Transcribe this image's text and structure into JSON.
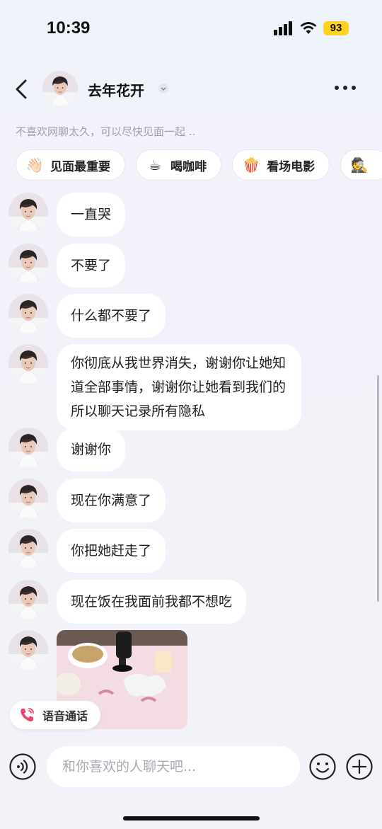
{
  "status_bar": {
    "time": "10:39",
    "battery": "93"
  },
  "header": {
    "contact_name": "去年花开",
    "subtitle": "不喜欢网聊太久，可以尽快见面一起 .."
  },
  "chips": [
    {
      "icon": "👋🏻",
      "label": "见面最重要"
    },
    {
      "icon": "☕",
      "label": "喝咖啡"
    },
    {
      "icon": "🍿",
      "label": "看场电影"
    },
    {
      "icon": "🕵",
      "label": ""
    }
  ],
  "messages": [
    {
      "text": "一直哭"
    },
    {
      "text": "不要了"
    },
    {
      "text": "什么都不要了"
    },
    {
      "text": "你彻底从我世界消失，谢谢你让她知道全部事情，谢谢你让她看到我们的所以聊天记录所有隐私"
    },
    {
      "text": "谢谢你"
    },
    {
      "text": "现在你满意了"
    },
    {
      "text": "你把她赶走了"
    },
    {
      "text": "现在饭在我面前我都不想吃"
    }
  ],
  "voice_call": {
    "label": "语音通话"
  },
  "input": {
    "placeholder": "和你喜欢的人聊天吧..."
  },
  "colors": {
    "accent_call": "#f0436b",
    "battery": "#ffd21f"
  }
}
